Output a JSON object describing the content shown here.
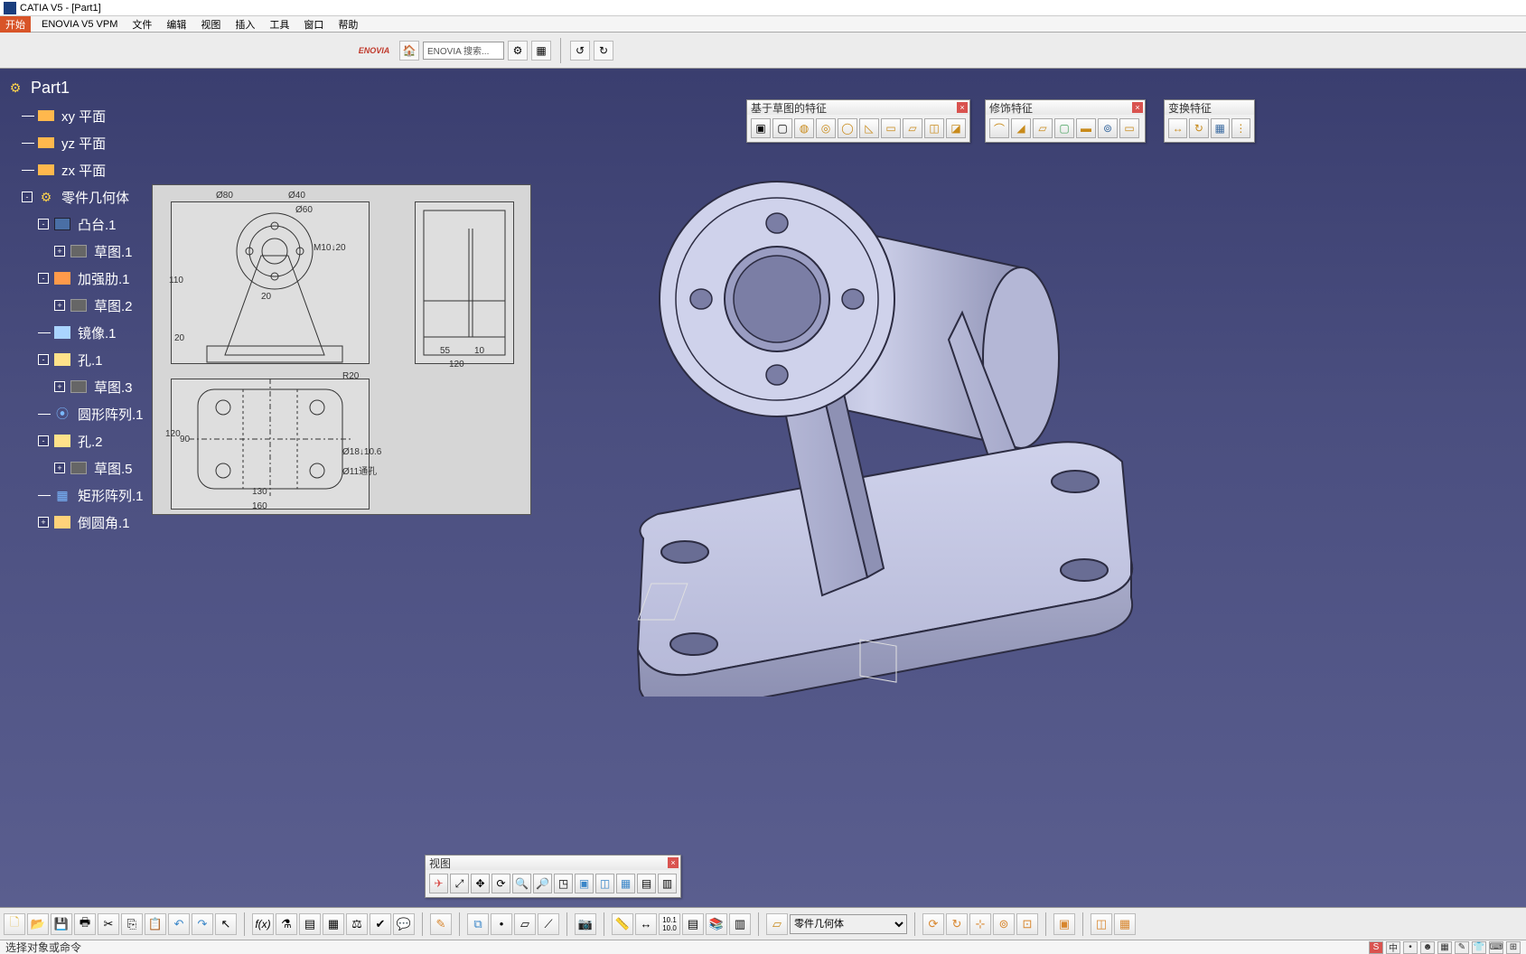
{
  "title": "CATIA V5 - [Part1]",
  "menu": {
    "start": "开始",
    "items": [
      "ENOVIA V5 VPM",
      "文件",
      "编辑",
      "视图",
      "插入",
      "工具",
      "窗口",
      "帮助"
    ]
  },
  "upperToolbar": {
    "logo": "ENOVIA",
    "searchPlaceholder": "ENOVIA 搜索..."
  },
  "tree": {
    "root": "Part1",
    "nodes": [
      {
        "label": "xy 平面",
        "icon": "plane",
        "indent": 1
      },
      {
        "label": "yz 平面",
        "icon": "plane",
        "indent": 1
      },
      {
        "label": "zx 平面",
        "icon": "plane",
        "indent": 1
      },
      {
        "label": "零件几何体",
        "icon": "body",
        "indent": 1,
        "toggle": "-"
      },
      {
        "label": "凸台.1",
        "icon": "pad",
        "indent": 2,
        "toggle": "-"
      },
      {
        "label": "草图.1",
        "icon": "sketch",
        "indent": 3,
        "toggle": "+"
      },
      {
        "label": "加强肋.1",
        "icon": "rib",
        "indent": 2,
        "toggle": "-"
      },
      {
        "label": "草图.2",
        "icon": "sketch",
        "indent": 3,
        "toggle": "+"
      },
      {
        "label": "镜像.1",
        "icon": "mirror",
        "indent": 2
      },
      {
        "label": "孔.1",
        "icon": "hole",
        "indent": 2,
        "toggle": "-"
      },
      {
        "label": "草图.3",
        "icon": "sketch",
        "indent": 3,
        "toggle": "+"
      },
      {
        "label": "圆形阵列.1",
        "icon": "pattern",
        "indent": 2
      },
      {
        "label": "孔.2",
        "icon": "hole",
        "indent": 2,
        "toggle": "-"
      },
      {
        "label": "草图.5",
        "icon": "sketch",
        "indent": 3,
        "toggle": "+"
      },
      {
        "label": "矩形阵列.1",
        "icon": "pattern",
        "indent": 2
      },
      {
        "label": "倒圆角.1",
        "icon": "fillet",
        "indent": 2,
        "toggle": "+"
      }
    ]
  },
  "blueprint": {
    "dims": [
      "Ø80",
      "Ø40",
      "Ø60",
      "M10↓20",
      "110",
      "20",
      "20",
      "55",
      "10",
      "120",
      "R20",
      "120",
      "90",
      "Ø18↓10.6",
      "Ø11通孔",
      "130",
      "160"
    ]
  },
  "floatToolbars": {
    "sketchFeat": {
      "title": "基于草图的特征",
      "buttons": [
        "pad",
        "pocket",
        "shaft",
        "groove",
        "hole",
        "rib",
        "solid-comb",
        "remove",
        "stiffener",
        "multi-section"
      ]
    },
    "dress": {
      "title": "修饰特征",
      "buttons": [
        "fillet",
        "chamfer",
        "draft",
        "draft-var",
        "shell",
        "thickness",
        "thread",
        "remove-face"
      ]
    },
    "transform": {
      "title": "变换特征",
      "buttons": [
        "translate",
        "rotate",
        "symmetry",
        "pattern"
      ]
    },
    "view": {
      "title": "视图",
      "buttons": [
        "fly",
        "fit-all",
        "pan",
        "rotate",
        "zoom-in",
        "zoom-out",
        "normal",
        "iso",
        "multi",
        "render",
        "hide",
        "swap"
      ]
    }
  },
  "bottomToolbar": {
    "bodySelectLabel": "零件几何体"
  },
  "status": {
    "left": "选择对象或命令",
    "imeBadge": "S",
    "imeText": "中"
  }
}
